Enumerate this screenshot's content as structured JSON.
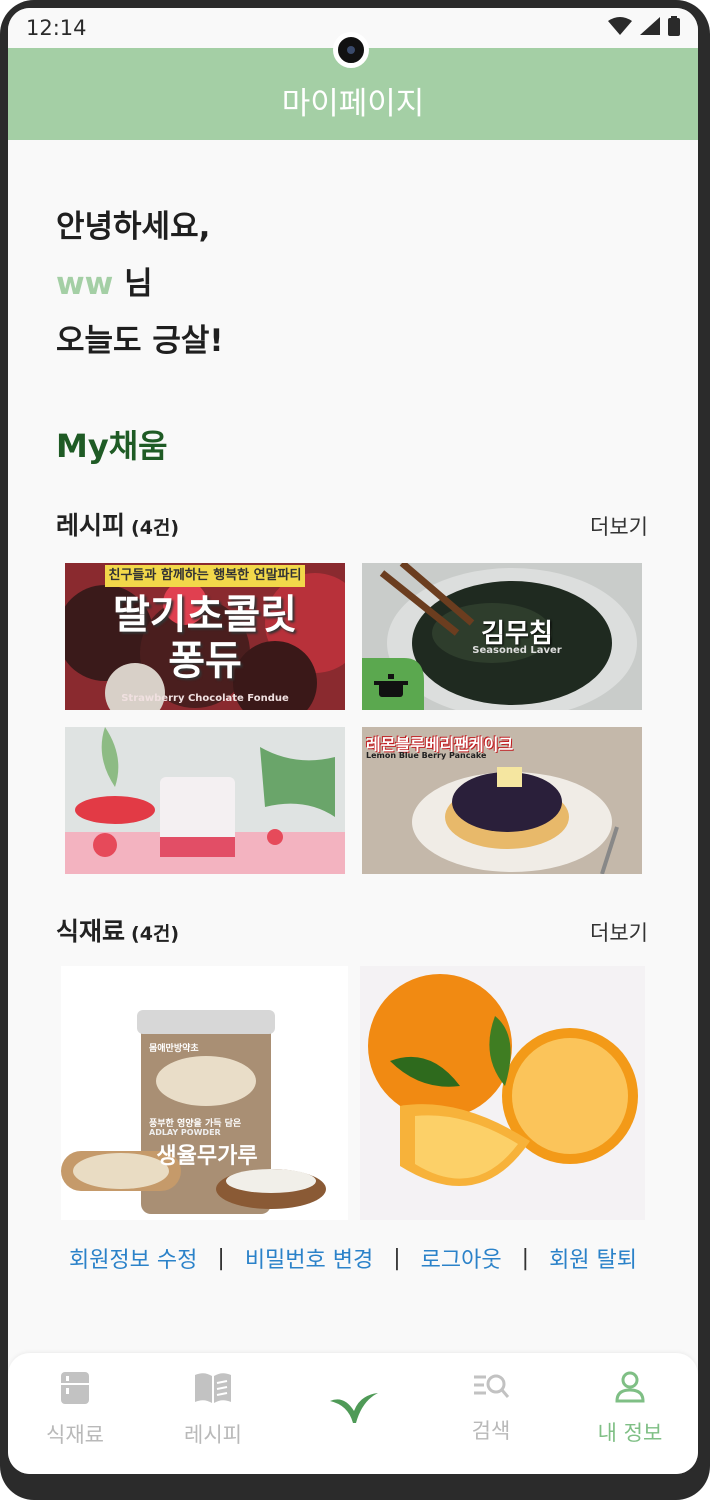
{
  "status": {
    "time": "12:14"
  },
  "header": {
    "title": "마이페이지"
  },
  "greeting": {
    "line1": "안녕하세요,",
    "username": "ww",
    "suffix": " 님",
    "line3": "오늘도 긍살!"
  },
  "my": {
    "title": "My채움"
  },
  "recipes": {
    "title": "레시피",
    "count": "(4건)",
    "more": "더보기",
    "items": [
      {
        "banner": "친구들과 함께하는 행복한 연말파티",
        "title_line1": "딸기초콜릿",
        "title_line2": "퐁듀",
        "subtitle": "Strawberry Chocolate Fondue"
      },
      {
        "title": "김무침",
        "subtitle": "Seasoned Laver"
      },
      {
        "title": ""
      },
      {
        "title": "레몬블루베리팬케이크",
        "subtitle": "Lemon Blue Berry Pancake"
      }
    ]
  },
  "ingredients": {
    "title": "식재료",
    "count": "(4건)",
    "more": "더보기",
    "items": [
      {
        "brand": "몸애만방약초",
        "tagline": "풍부한 영양을 가득 담은",
        "eng": "ADLAY POWDER",
        "name": "생율무가루"
      },
      {
        "name": ""
      }
    ]
  },
  "links": {
    "edit": "회원정보 수정",
    "password": "비밀번호 변경",
    "logout": "로그아웃",
    "withdraw": "회원 탈퇴",
    "sep": "|"
  },
  "nav": {
    "items": [
      {
        "label": "식재료",
        "icon": "fridge-icon"
      },
      {
        "label": "레시피",
        "icon": "book-icon"
      },
      {
        "label": "",
        "icon": "sprout-icon"
      },
      {
        "label": "검색",
        "icon": "search-list-icon"
      },
      {
        "label": "내 정보",
        "icon": "person-icon"
      }
    ],
    "active": "내 정보"
  },
  "colors": {
    "header": "#a4cfa5",
    "accent_dark": "#1f5b25",
    "link": "#2b82c9",
    "nav_active": "#7fbf85"
  }
}
